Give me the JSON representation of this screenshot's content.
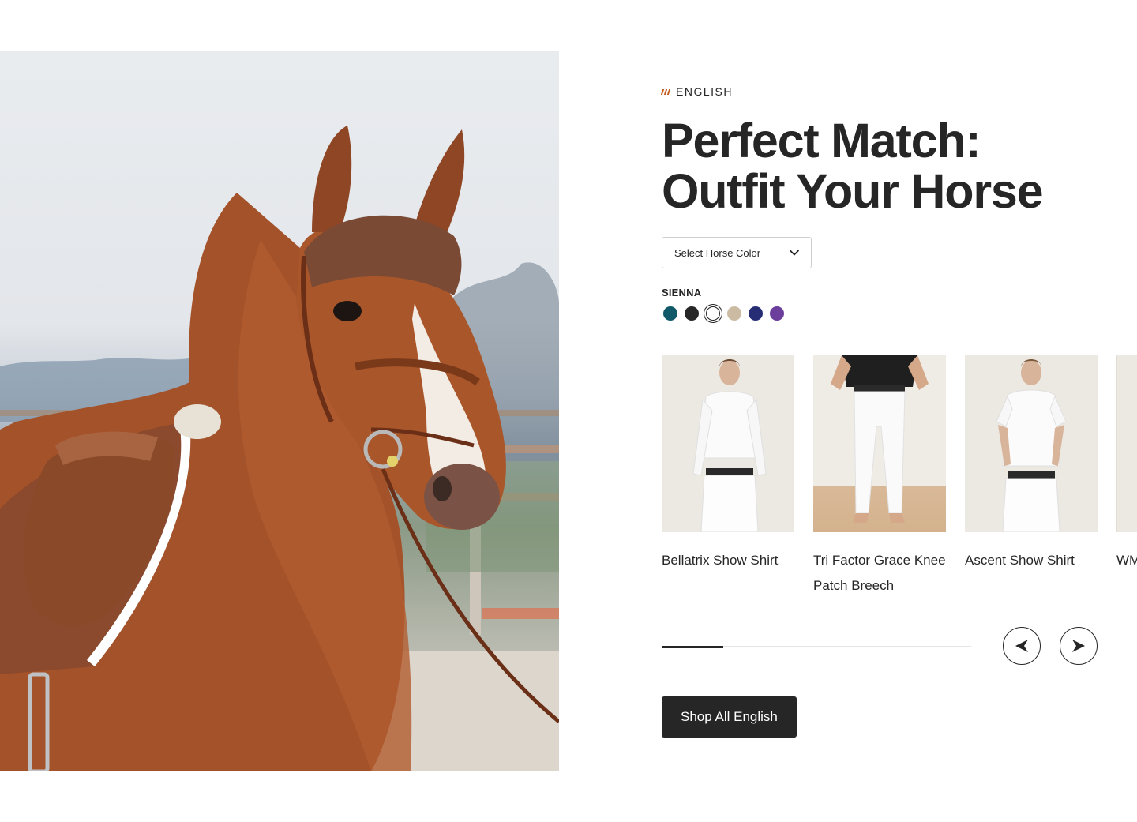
{
  "hero": {
    "image_alt": "Chestnut horse with brown ear bonnet, bridle and saddle"
  },
  "eyebrow": {
    "label": "ENGLISH",
    "accent_color": "#c45a1c"
  },
  "title": {
    "line1": "Perfect Match:",
    "line2": "Outfit Your Horse"
  },
  "horse_color_select": {
    "label": "Select Horse Color",
    "icon": "chevron-down-icon"
  },
  "color": {
    "selected_name": "SIENNA",
    "swatches": [
      {
        "name": "teal",
        "hex": "#0f5968"
      },
      {
        "name": "black",
        "hex": "#262626"
      },
      {
        "name": "sienna",
        "hex": "#ffffff",
        "selected": true
      },
      {
        "name": "tan",
        "hex": "#cbbba3"
      },
      {
        "name": "navy",
        "hex": "#262d74"
      },
      {
        "name": "purple",
        "hex": "#6d3f9c"
      }
    ]
  },
  "products": [
    {
      "name": "Bellatrix Show Shirt"
    },
    {
      "name": "Tri Factor Grace Knee Patch Breech"
    },
    {
      "name": "Ascent Show Shirt"
    },
    {
      "name": "WM Ful"
    }
  ],
  "carousel": {
    "progress": 0.2,
    "prev_icon": "arrow-left-icon",
    "next_icon": "arrow-right-icon"
  },
  "cta": {
    "label": "Shop All English"
  }
}
